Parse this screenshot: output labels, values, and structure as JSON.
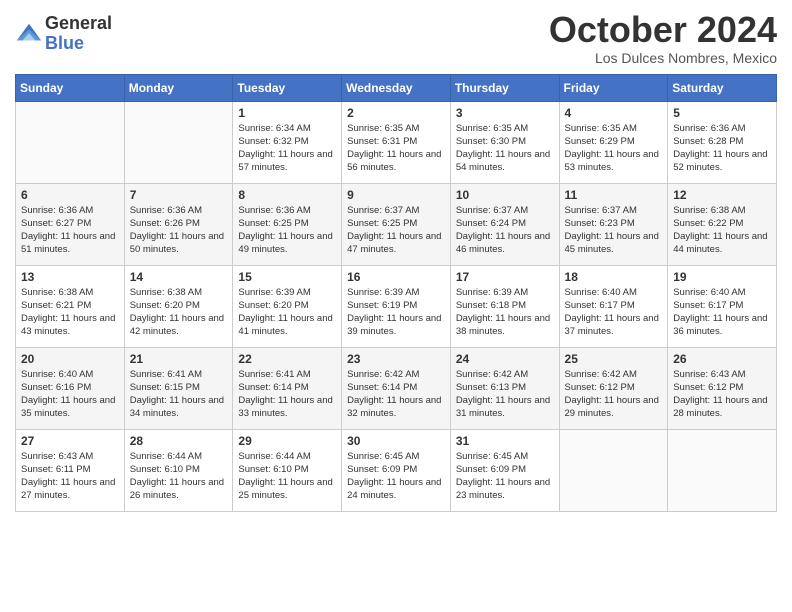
{
  "header": {
    "logo_general": "General",
    "logo_blue": "Blue",
    "month_title": "October 2024",
    "location": "Los Dulces Nombres, Mexico"
  },
  "weekdays": [
    "Sunday",
    "Monday",
    "Tuesday",
    "Wednesday",
    "Thursday",
    "Friday",
    "Saturday"
  ],
  "weeks": [
    [
      {
        "day": "",
        "info": ""
      },
      {
        "day": "",
        "info": ""
      },
      {
        "day": "1",
        "info": "Sunrise: 6:34 AM\nSunset: 6:32 PM\nDaylight: 11 hours and 57 minutes."
      },
      {
        "day": "2",
        "info": "Sunrise: 6:35 AM\nSunset: 6:31 PM\nDaylight: 11 hours and 56 minutes."
      },
      {
        "day": "3",
        "info": "Sunrise: 6:35 AM\nSunset: 6:30 PM\nDaylight: 11 hours and 54 minutes."
      },
      {
        "day": "4",
        "info": "Sunrise: 6:35 AM\nSunset: 6:29 PM\nDaylight: 11 hours and 53 minutes."
      },
      {
        "day": "5",
        "info": "Sunrise: 6:36 AM\nSunset: 6:28 PM\nDaylight: 11 hours and 52 minutes."
      }
    ],
    [
      {
        "day": "6",
        "info": "Sunrise: 6:36 AM\nSunset: 6:27 PM\nDaylight: 11 hours and 51 minutes."
      },
      {
        "day": "7",
        "info": "Sunrise: 6:36 AM\nSunset: 6:26 PM\nDaylight: 11 hours and 50 minutes."
      },
      {
        "day": "8",
        "info": "Sunrise: 6:36 AM\nSunset: 6:25 PM\nDaylight: 11 hours and 49 minutes."
      },
      {
        "day": "9",
        "info": "Sunrise: 6:37 AM\nSunset: 6:25 PM\nDaylight: 11 hours and 47 minutes."
      },
      {
        "day": "10",
        "info": "Sunrise: 6:37 AM\nSunset: 6:24 PM\nDaylight: 11 hours and 46 minutes."
      },
      {
        "day": "11",
        "info": "Sunrise: 6:37 AM\nSunset: 6:23 PM\nDaylight: 11 hours and 45 minutes."
      },
      {
        "day": "12",
        "info": "Sunrise: 6:38 AM\nSunset: 6:22 PM\nDaylight: 11 hours and 44 minutes."
      }
    ],
    [
      {
        "day": "13",
        "info": "Sunrise: 6:38 AM\nSunset: 6:21 PM\nDaylight: 11 hours and 43 minutes."
      },
      {
        "day": "14",
        "info": "Sunrise: 6:38 AM\nSunset: 6:20 PM\nDaylight: 11 hours and 42 minutes."
      },
      {
        "day": "15",
        "info": "Sunrise: 6:39 AM\nSunset: 6:20 PM\nDaylight: 11 hours and 41 minutes."
      },
      {
        "day": "16",
        "info": "Sunrise: 6:39 AM\nSunset: 6:19 PM\nDaylight: 11 hours and 39 minutes."
      },
      {
        "day": "17",
        "info": "Sunrise: 6:39 AM\nSunset: 6:18 PM\nDaylight: 11 hours and 38 minutes."
      },
      {
        "day": "18",
        "info": "Sunrise: 6:40 AM\nSunset: 6:17 PM\nDaylight: 11 hours and 37 minutes."
      },
      {
        "day": "19",
        "info": "Sunrise: 6:40 AM\nSunset: 6:17 PM\nDaylight: 11 hours and 36 minutes."
      }
    ],
    [
      {
        "day": "20",
        "info": "Sunrise: 6:40 AM\nSunset: 6:16 PM\nDaylight: 11 hours and 35 minutes."
      },
      {
        "day": "21",
        "info": "Sunrise: 6:41 AM\nSunset: 6:15 PM\nDaylight: 11 hours and 34 minutes."
      },
      {
        "day": "22",
        "info": "Sunrise: 6:41 AM\nSunset: 6:14 PM\nDaylight: 11 hours and 33 minutes."
      },
      {
        "day": "23",
        "info": "Sunrise: 6:42 AM\nSunset: 6:14 PM\nDaylight: 11 hours and 32 minutes."
      },
      {
        "day": "24",
        "info": "Sunrise: 6:42 AM\nSunset: 6:13 PM\nDaylight: 11 hours and 31 minutes."
      },
      {
        "day": "25",
        "info": "Sunrise: 6:42 AM\nSunset: 6:12 PM\nDaylight: 11 hours and 29 minutes."
      },
      {
        "day": "26",
        "info": "Sunrise: 6:43 AM\nSunset: 6:12 PM\nDaylight: 11 hours and 28 minutes."
      }
    ],
    [
      {
        "day": "27",
        "info": "Sunrise: 6:43 AM\nSunset: 6:11 PM\nDaylight: 11 hours and 27 minutes."
      },
      {
        "day": "28",
        "info": "Sunrise: 6:44 AM\nSunset: 6:10 PM\nDaylight: 11 hours and 26 minutes."
      },
      {
        "day": "29",
        "info": "Sunrise: 6:44 AM\nSunset: 6:10 PM\nDaylight: 11 hours and 25 minutes."
      },
      {
        "day": "30",
        "info": "Sunrise: 6:45 AM\nSunset: 6:09 PM\nDaylight: 11 hours and 24 minutes."
      },
      {
        "day": "31",
        "info": "Sunrise: 6:45 AM\nSunset: 6:09 PM\nDaylight: 11 hours and 23 minutes."
      },
      {
        "day": "",
        "info": ""
      },
      {
        "day": "",
        "info": ""
      }
    ]
  ]
}
